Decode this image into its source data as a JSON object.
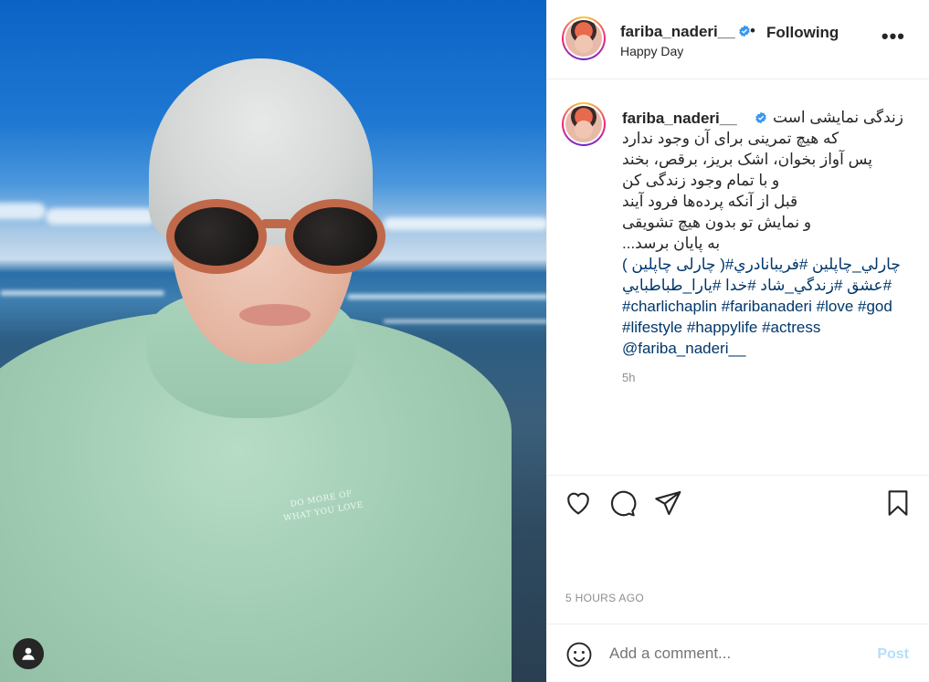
{
  "post": {
    "username": "fariba_naderi__",
    "follow_status": "Following",
    "separator": "•",
    "location": "Happy Day",
    "more_label": "•••"
  },
  "photo": {
    "shirt_text_line1": "DO MORE OF",
    "shirt_text_line2": "WHAT YOU LOVE"
  },
  "caption": {
    "username": "fariba_naderi__",
    "lines": [
      "زندگی نمایشی است",
      "که هیچ تمرینی برای آن وجود ندارد",
      "پس آواز بخوان، اشک بریز، برقص، بخند",
      "و با تمام وجود زندگی کن",
      "قبل از آنکه پرده‌ها فرود آیند",
      "و نمایش تو بدون هیچ تشویقی",
      "به پایان برسد..."
    ],
    "hashtags_rtl_1": "چارلي_چاپلين #فريبانادري#( چارلی چاپلین )",
    "hashtags_rtl_2": "#عشق #زندگي_شاد #خدا #يارا_طباطبايي",
    "hashtags_ltr_1": "#charlichaplin #faribanaderi #love #god",
    "hashtags_ltr_2": "#lifestyle #happylife #actress",
    "mention": "@fariba_naderi__",
    "time_ago": "5h"
  },
  "actions": {
    "like": "heart-icon",
    "comment": "comment-icon",
    "share": "paper-plane-icon",
    "save": "bookmark-icon"
  },
  "timestamp": "5 HOURS AGO",
  "comment": {
    "placeholder": "Add a comment...",
    "post_label": "Post"
  },
  "colors": {
    "text": "#262626",
    "muted": "#8e8e8e",
    "link": "#00376b",
    "post_disabled": "#b2dffc",
    "verified": "#3897f0"
  }
}
